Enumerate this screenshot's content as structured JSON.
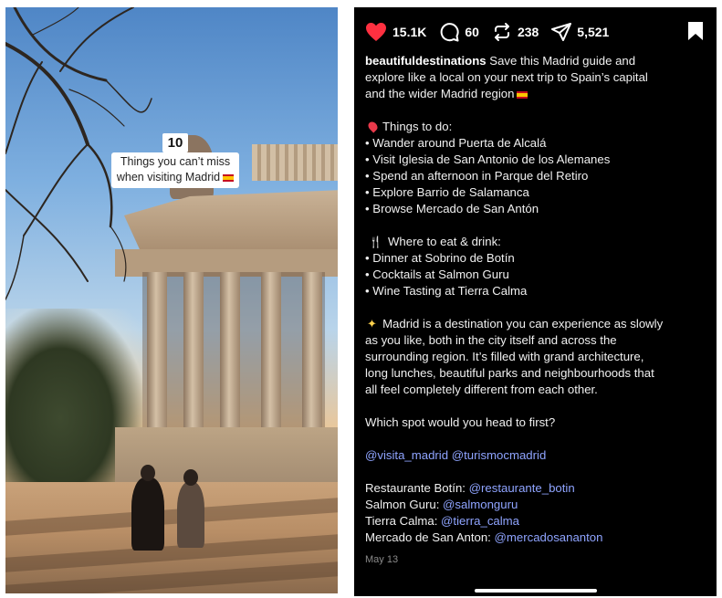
{
  "left_panel": {
    "caption": {
      "number": "10",
      "line1": "Things you can’t miss",
      "line2": "when visiting Madrid"
    }
  },
  "post": {
    "actions": {
      "likes": "15.1K",
      "comments": "60",
      "reposts": "238",
      "shares": "5,521"
    },
    "username": "beautifuldestinations",
    "intro_1": " Save this Madrid guide and",
    "intro_2": "explore like a local on your next trip to Spain’s capital",
    "intro_3": "and the wider Madrid region",
    "things_heading": "Things to do:",
    "things": [
      "• Wander around Puerta de Alcalá",
      "• Visit Iglesia de San Antonio de los Alemanes",
      "• Spend an afternoon in Parque del Retiro",
      "• Explore Barrio de Salamanca",
      "• Browse Mercado de San Antón"
    ],
    "eat_heading": "Where to eat & drink:",
    "eat": [
      "• Dinner at Sobrino de Botín",
      "• Cocktails at Salmon Guru",
      "• Wine Tasting at Tierra Calma"
    ],
    "para": [
      "Madrid is a destination you can experience as slowly",
      "as you like, both in the city itself and across the",
      "surrounding region. It’s filled with grand architecture,",
      "long lunches, beautiful parks and neighbourhoods that",
      "all feel completely different from each other."
    ],
    "question": "Which spot would you head to first?",
    "tags": {
      "tag1": "@visita_madrid",
      "tag2": "@turismocmadrid"
    },
    "credits": [
      {
        "label": "Restaurante Botín: ",
        "handle": "@restaurante_botin"
      },
      {
        "label": "Salmon Guru: ",
        "handle": "@salmonguru"
      },
      {
        "label": "Tierra Calma: ",
        "handle": "@tierra_calma"
      },
      {
        "label": "Mercado de San Anton: ",
        "handle": "@mercadosananton"
      }
    ],
    "date": "May 13"
  },
  "colors": {
    "post_bg": "#000000",
    "like_red": "#ff3040",
    "mention_blue": "#8fa4ff"
  },
  "icons": [
    "heart-icon",
    "comment-icon",
    "repost-icon",
    "share-icon",
    "bookmark-icon",
    "pin-icon",
    "fork-knife-icon",
    "sparkles-icon",
    "spain-flag-icon"
  ]
}
